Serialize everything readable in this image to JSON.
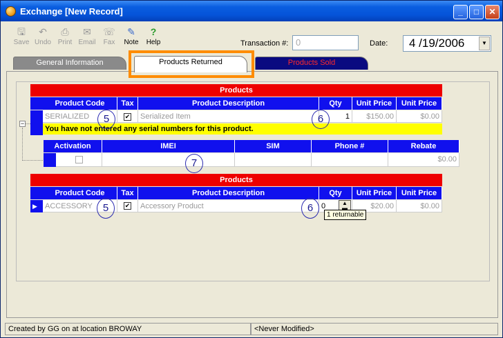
{
  "window": {
    "title": "Exchange [New Record]"
  },
  "toolbar": {
    "save": "Save",
    "undo": "Undo",
    "print": "Print",
    "email": "Email",
    "fax": "Fax",
    "note": "Note",
    "help": "Help"
  },
  "fields": {
    "transaction_label": "Transaction #:",
    "transaction_value": "0",
    "date_label": "Date:",
    "date_value": "4 /19/2006"
  },
  "tabs": [
    {
      "label": "General Information"
    },
    {
      "label": "Products Returned"
    },
    {
      "label": "Products Sold"
    }
  ],
  "returned_grid": {
    "title": "Products",
    "headers": [
      "Product Code",
      "Tax",
      "Product Description",
      "Qty",
      "Unit Price",
      "Unit Price"
    ],
    "row": {
      "code": "SERIALIZED",
      "desc": "Serialized Item",
      "qty": "1",
      "price1": "$150.00",
      "price2": "$0.00"
    },
    "warning": "You have not entered any serial numbers for this product.",
    "serial_headers": [
      "Activation",
      "IMEI",
      "SIM",
      "Phone #",
      "Rebate"
    ],
    "serial_row": {
      "rebate": "$0.00"
    }
  },
  "sold_grid": {
    "title": "Products",
    "headers": [
      "Product Code",
      "Tax",
      "Product Description",
      "Qty",
      "Unit Price",
      "Unit Price"
    ],
    "row": {
      "code": "ACCESSORY",
      "desc": "Accessory Product",
      "qty": "0",
      "price1": "$20.00",
      "price2": "$0.00"
    }
  },
  "tooltip": "1 returnable",
  "annotations": {
    "a5": "5",
    "a6": "6",
    "a7": "7"
  },
  "status": {
    "left": "Created by GG on  at location BROWAY",
    "right": "<Never Modified>"
  }
}
